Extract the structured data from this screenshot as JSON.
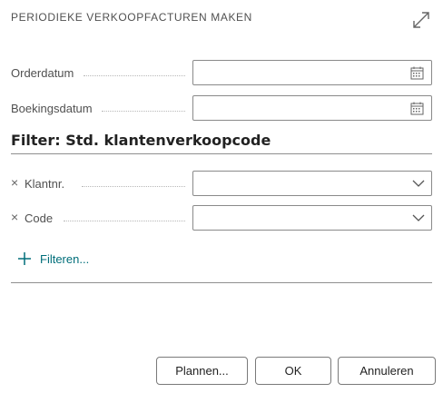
{
  "dialog": {
    "title": "PERIODIEKE VERKOOPFACTUREN MAKEN"
  },
  "fields": [
    {
      "label": "Orderdatum",
      "value": "",
      "icon": "calendar-icon"
    },
    {
      "label": "Boekingsdatum",
      "value": "",
      "icon": "calendar-icon"
    }
  ],
  "filter": {
    "title": "Filter: Std. klantenverkoopcode",
    "rows": [
      {
        "remove": "×",
        "label": "Klantnr.",
        "value": "",
        "icon": "chevron-down-icon"
      },
      {
        "remove": "×",
        "label": "Code",
        "value": "",
        "icon": "chevron-down-icon"
      }
    ],
    "add_label": "Filteren..."
  },
  "buttons": {
    "plan": "Plannen...",
    "ok": "OK",
    "cancel": "Annuleren"
  },
  "colors": {
    "accent": "#006e7a",
    "border": "#8a8a8a",
    "text": "#333333"
  }
}
